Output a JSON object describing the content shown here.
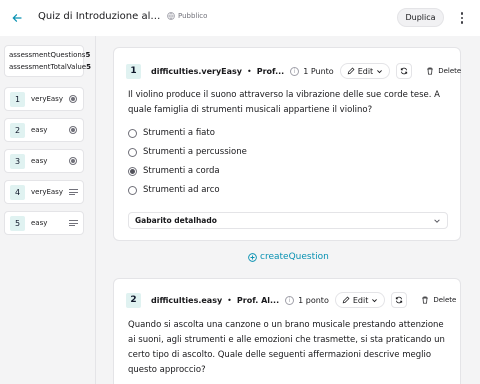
{
  "header": {
    "title": "Quiz di Introduzione alla Musica",
    "visibility": "Pubblico",
    "duplicate_label": "Duplica"
  },
  "sidebar": {
    "meta": [
      {
        "key": "assessmentQuestions",
        "value": "5"
      },
      {
        "key": "assessmentTotalValue",
        "value": "5"
      }
    ],
    "questions": [
      {
        "number": "1",
        "difficulty": "veryEasy",
        "icon": "radio-icon"
      },
      {
        "number": "2",
        "difficulty": "easy",
        "icon": "radio-icon"
      },
      {
        "number": "3",
        "difficulty": "easy",
        "icon": "radio-icon"
      },
      {
        "number": "4",
        "difficulty": "veryEasy",
        "icon": "text-lines-icon"
      },
      {
        "number": "5",
        "difficulty": "easy",
        "icon": "text-lines-icon"
      }
    ]
  },
  "questions": [
    {
      "number": "1",
      "difficulty": "difficulties.veryEasy",
      "author": "Prof...",
      "points": "1 Punto",
      "edit_label": "Edit",
      "delete_label": "Delete",
      "text": "Il violino produce il suono attraverso la vibrazione delle sue corde tese. A quale famiglia di strumenti musicali appartiene il violino?",
      "options": [
        {
          "label": "Strumenti a fiato",
          "selected": false
        },
        {
          "label": "Strumenti a percussione",
          "selected": false
        },
        {
          "label": "Strumenti a corda",
          "selected": true
        },
        {
          "label": "Strumenti ad arco",
          "selected": false
        }
      ],
      "feedback_label": "Gabarito detalhado"
    },
    {
      "number": "2",
      "difficulty": "difficulties.easy",
      "author": "Prof. Al...",
      "points": "1 ponto",
      "edit_label": "Edit",
      "delete_label": "Delete",
      "text": "Quando si ascolta una canzone o un brano musicale prestando attenzione ai suoni, agli strumenti e alle emozioni che trasmette, si sta praticando un certo tipo di ascolto. Quale delle seguenti affermazioni descrive meglio questo approccio?"
    }
  ],
  "create_question_label": "createQuestion",
  "colors": {
    "accent": "#0891b2",
    "badge_bg": "#e0f2f1",
    "page_bg": "#f4f4f5"
  }
}
